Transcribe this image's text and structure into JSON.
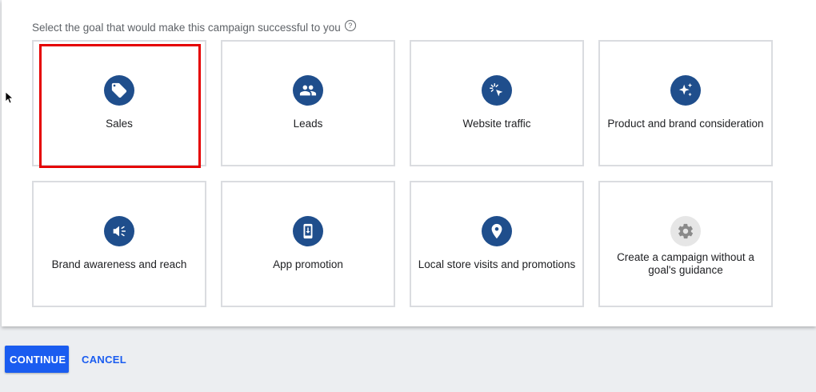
{
  "prompt": {
    "text": "Select the goal that would make this campaign successful to you",
    "help_icon": "help-circle-icon"
  },
  "goals": [
    {
      "label": "Sales",
      "icon": "tag-icon",
      "selected": true
    },
    {
      "label": "Leads",
      "icon": "people-icon",
      "selected": false
    },
    {
      "label": "Website traffic",
      "icon": "cursor-click-icon",
      "selected": false
    },
    {
      "label": "Product and brand consideration",
      "icon": "sparkle-icon",
      "selected": false
    },
    {
      "label": "Brand awareness and reach",
      "icon": "speaker-icon",
      "selected": false
    },
    {
      "label": "App promotion",
      "icon": "phone-download-icon",
      "selected": false
    },
    {
      "label": "Local store visits and promotions",
      "icon": "location-pin-icon",
      "selected": false
    },
    {
      "label": "Create a campaign without a goal's guidance",
      "icon": "gear-icon",
      "selected": false
    }
  ],
  "actions": {
    "continue_label": "CONTINUE",
    "cancel_label": "CANCEL"
  },
  "colors": {
    "icon_bg": "#1f4e8c",
    "icon_bg_disabled": "#e6e6e6",
    "selection_border": "#e50000",
    "primary": "#1a5cf0"
  }
}
